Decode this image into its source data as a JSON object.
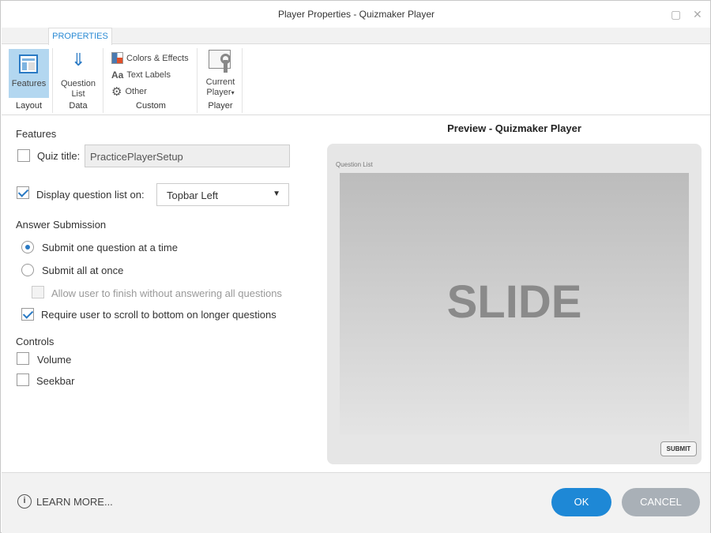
{
  "window": {
    "title": "Player Properties - Quizmaker Player"
  },
  "ribbon": {
    "tab": "PROPERTIES",
    "features": "Features",
    "layout_group": "Layout",
    "question_list": [
      "Question",
      "List"
    ],
    "data_group": "Data",
    "colors": "Colors & Effects",
    "text_labels": "Text Labels",
    "other": "Other",
    "custom_group": "Custom",
    "current_player": [
      "Current",
      "Player"
    ],
    "player_group": "Player"
  },
  "features": {
    "heading": "Features",
    "quiz_title_label": "Quiz title:",
    "quiz_title_value": "PracticePlayerSetup",
    "display_list_label": "Display question list on:",
    "display_list_value": "Topbar Left"
  },
  "answer": {
    "heading": "Answer Submission",
    "one": "Submit one question at a time",
    "all": "Submit all at once",
    "allow": "Allow user to finish without answering all questions",
    "scroll": "Require user to scroll to bottom on longer questions"
  },
  "controls": {
    "heading": "Controls",
    "volume": "Volume",
    "seekbar": "Seekbar"
  },
  "preview": {
    "title": "Preview - Quizmaker Player",
    "question_list": "Question List",
    "slide": "SLIDE",
    "submit": "SUBMIT"
  },
  "footer": {
    "learn_more": "LEARN MORE...",
    "ok": "OK",
    "cancel": "CANCEL"
  }
}
